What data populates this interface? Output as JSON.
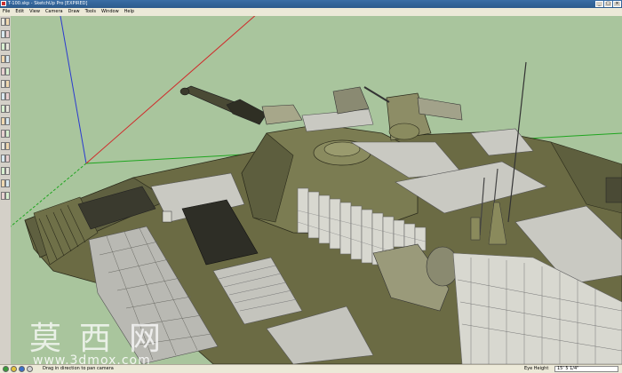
{
  "window": {
    "title": "T-100.skp - SketchUp Pro [EXPIRED]",
    "minimize": "_",
    "maximize": "□",
    "close": "×"
  },
  "menu": [
    "File",
    "Edit",
    "View",
    "Camera",
    "Draw",
    "Tools",
    "Window",
    "Help"
  ],
  "toolbar": {
    "tools": [
      "select-tool",
      "eraser-tool",
      "rectangle-tool",
      "line-tool",
      "circle-tool",
      "arc-tool",
      "polygon-tool",
      "freehand-tool",
      "move-tool",
      "push-pull-tool",
      "rotate-tool",
      "follow-me-tool",
      "scale-tool",
      "offset-tool",
      "tape-measure-tool",
      "dimension-tool",
      "protractor-tool",
      "text-tool",
      "axes-tool",
      "3d-text-tool",
      "orbit-tool",
      "pan-tool",
      "zoom-tool",
      "zoom-window-tool",
      "zoom-extents-tool",
      "previous-view-tool",
      "position-camera-tool",
      "look-around-tool",
      "walk-tool",
      "section-plane-tool"
    ]
  },
  "viewport": {
    "sky_color": "#a9c59d",
    "hull_color": "#6b6b44",
    "axis_colors": {
      "red": "#d02a2a",
      "green": "#1fa51f",
      "blue": "#2a3ad0"
    }
  },
  "status": {
    "hint": "Drag in direction to pan camera",
    "measurement_label": "Eye Height",
    "measurement_value": "15' 5 1/4\""
  },
  "watermark": {
    "brand": "莫西网",
    "url": "www.3dmox.com"
  }
}
